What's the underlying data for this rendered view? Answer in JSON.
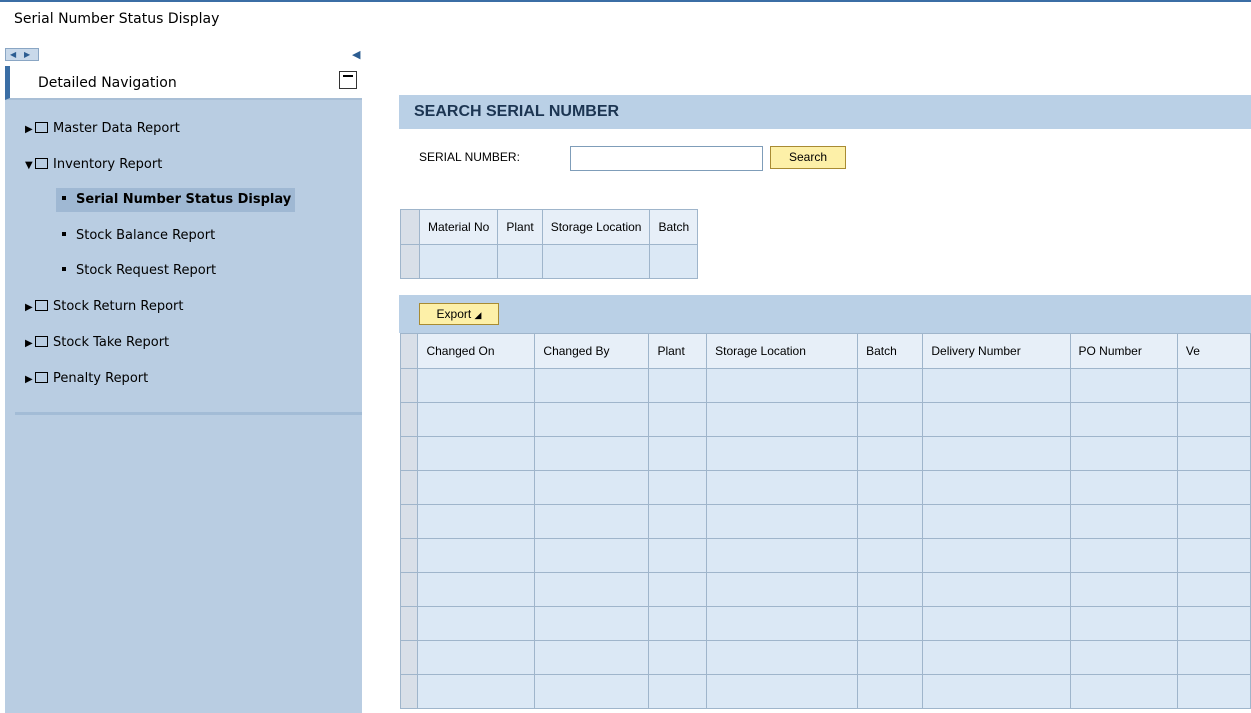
{
  "page": {
    "title": "Serial Number Status Display"
  },
  "nav": {
    "header": "Detailed Navigation",
    "items": [
      {
        "label": "Master Data Report",
        "expanded": false
      },
      {
        "label": "Inventory Report",
        "expanded": true
      },
      {
        "label": "Serial Number Status Display",
        "selected": true
      },
      {
        "label": "Stock Balance Report"
      },
      {
        "label": "Stock Request Report"
      },
      {
        "label": "Stock Return Report",
        "expanded": false
      },
      {
        "label": "Stock Take Report",
        "expanded": false
      },
      {
        "label": "Penalty Report",
        "expanded": false
      }
    ]
  },
  "search": {
    "section_title": "SEARCH SERIAL NUMBER",
    "field_label": "SERIAL NUMBER:",
    "field_value": "",
    "button_label": "Search"
  },
  "grid1": {
    "headers": [
      "Material No",
      "Plant",
      "Storage Location",
      "Batch"
    ]
  },
  "grid2": {
    "export_label": "Export",
    "headers": [
      "Changed On",
      "Changed By",
      "Plant",
      "Storage Location",
      "Batch",
      "Delivery Number",
      "PO Number",
      "Ve"
    ]
  },
  "colors": {
    "accent": "#3b6ea5",
    "sidebar": "#b9cde2",
    "header_band": "#bad0e6",
    "button": "#fdf0a8"
  }
}
